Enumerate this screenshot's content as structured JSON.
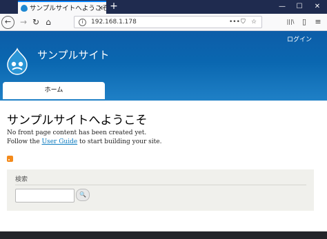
{
  "browser": {
    "tab_title": "サンプルサイトへようこそ | サ",
    "tab_close": "✕",
    "new_tab": "+",
    "window": {
      "minimize": "—",
      "maximize": "☐",
      "close": "✕"
    },
    "nav": {
      "back": "←",
      "forward": "→",
      "reload": "↻",
      "home": "⌂"
    },
    "url": "192.168.1.178",
    "url_info": "i",
    "page_actions": "•••",
    "pocket": "⛉",
    "star": "☆",
    "library": "|||\\",
    "sidebar": "▯",
    "menu": "≡"
  },
  "site": {
    "login": "ログイン",
    "name": "サンプルサイト",
    "nav_home": "ホーム"
  },
  "content": {
    "title": "サンプルサイトへようこそ",
    "line1": "No front page content has been created yet.",
    "line2_pre": "Follow the ",
    "line2_link": "User Guide",
    "line2_post": " to start building your site."
  },
  "search": {
    "label": "検索",
    "button": "🔍"
  },
  "colors": {
    "header": "#0a67b0",
    "link": "#0678be",
    "rss": "#f48a1a"
  }
}
